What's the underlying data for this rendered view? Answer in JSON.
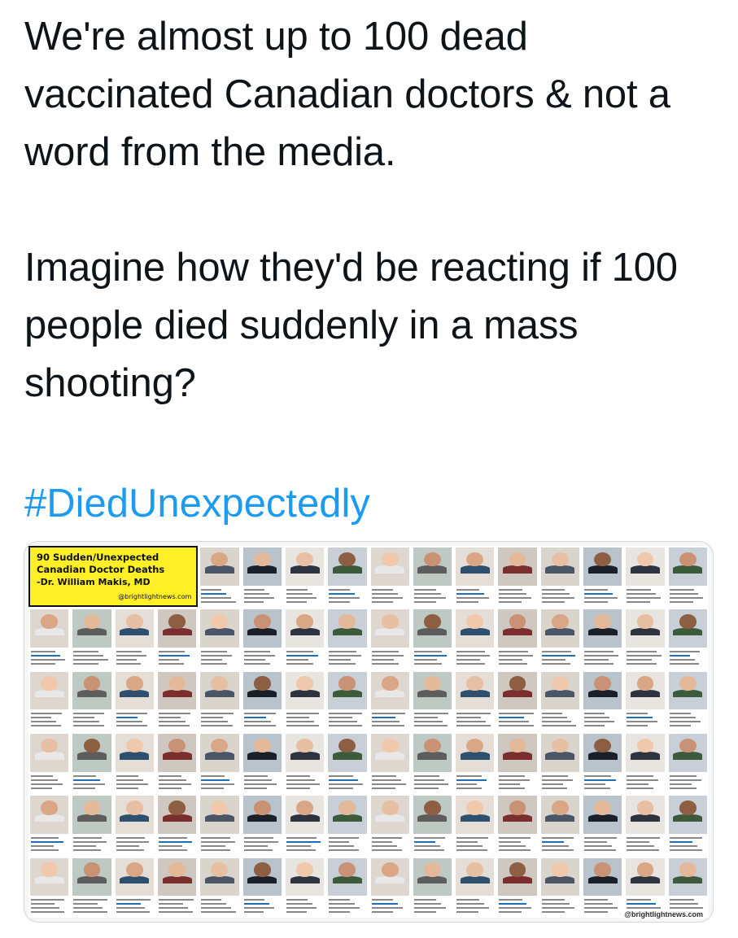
{
  "tweet": {
    "paragraph1": "We're almost up to 100 dead vaccinated Canadian doctors & not a word from the media.",
    "paragraph2": "Imagine how they'd be reacting if 100 people died suddenly in a mass shooting?",
    "hashtag": "#DiedUnexpectedly"
  },
  "media": {
    "box": {
      "line1": "90 Sudden/Unexpected",
      "line2": "Canadian Doctor Deaths",
      "line3": "-Dr. William Makis, MD",
      "site": "@brightlightnews.com"
    },
    "watermark": "@brightlightnews.com",
    "tile_colors": {
      "backgrounds": [
        "#d9d4cc",
        "#c9cfd6",
        "#e4ded6",
        "#b9c3cc",
        "#ddd7cf",
        "#cfc8c0",
        "#e8e4df",
        "#bfc9c3"
      ],
      "skin": [
        "#e3b99a",
        "#d9a786",
        "#c99274",
        "#f0c8ac",
        "#8d5e42",
        "#e7bfa2"
      ],
      "clothing": [
        "#2d3440",
        "#1b1f27",
        "#4a5568",
        "#7a2e2e",
        "#2f4f6f",
        "#5d5d5d",
        "#e8e8e8",
        "#3b5b3b"
      ]
    }
  }
}
